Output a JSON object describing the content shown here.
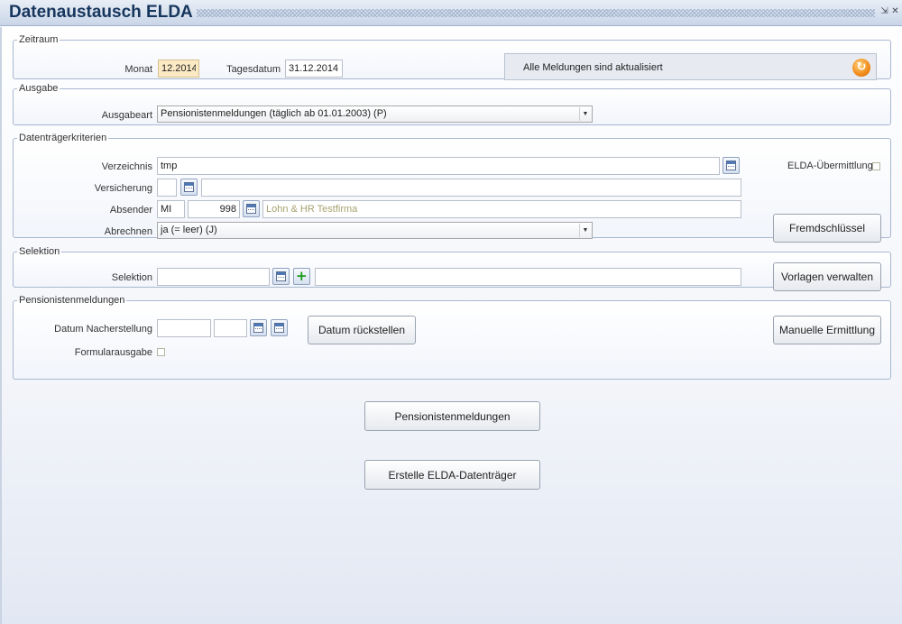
{
  "window": {
    "title": "Datenaustausch ELDA",
    "minimize_glyph": "⇲",
    "close_glyph": "✕"
  },
  "zeitraum": {
    "legend": "Zeitraum",
    "monat_label": "Monat",
    "monat_value": "12.2014",
    "tagesdatum_label": "Tagesdatum",
    "tagesdatum_value": "31.12.2014",
    "status_text": "Alle Meldungen sind aktualisiert",
    "refresh_icon": "refresh-icon"
  },
  "ausgabe": {
    "legend": "Ausgabe",
    "ausgabeart_label": "Ausgabeart",
    "ausgabeart_value": "Pensionistenmeldungen (täglich ab 01.01.2003) (P)"
  },
  "datentraeger": {
    "legend": "Datenträgerkriterien",
    "verzeichnis_label": "Verzeichnis",
    "verzeichnis_value": "tmp",
    "versicherung_label": "Versicherung",
    "versicherung_code": "",
    "versicherung_name": "",
    "absender_label": "Absender",
    "absender_code": "MI",
    "absender_number": "998",
    "absender_name": "Lohn & HR Testfirma",
    "abrechnen_label": "Abrechnen",
    "abrechnen_value": "ja (= leer) (J)",
    "elda_label": "ELDA-Übermittlung",
    "elda_checked": false,
    "fremdschluessel_button": "Fremdschlüssel"
  },
  "selektion": {
    "legend": "Selektion",
    "selektion_label": "Selektion",
    "selektion_value": "",
    "selektion_desc": "",
    "vorlagen_button": "Vorlagen verwalten"
  },
  "pensionisten": {
    "legend": "Pensionistenmeldungen",
    "datum_label": "Datum Nacherstellung",
    "datum_value_1": "",
    "datum_value_2": "",
    "rueckstellen_button": "Datum rückstellen",
    "manuelle_button": "Manuelle Ermittlung",
    "formular_label": "Formularausgabe",
    "formular_checked": false
  },
  "actions": {
    "pensionistenmeldungen_button": "Pensionistenmeldungen",
    "erstelle_button": "Erstelle ELDA-Datenträger"
  }
}
